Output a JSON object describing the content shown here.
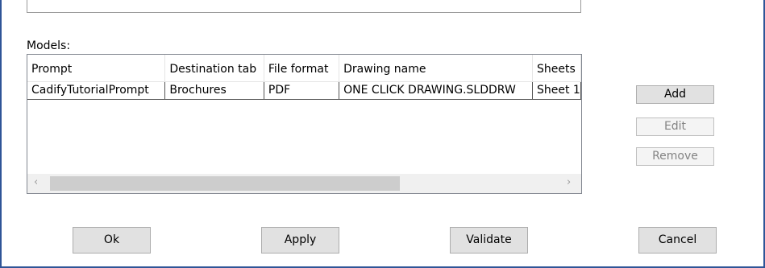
{
  "models_label": "Models:",
  "columns": [
    "Prompt",
    "Destination tab",
    "File format",
    "Drawing name",
    "Sheets"
  ],
  "rows": [
    [
      "CadifyTutorialPrompt",
      "Brochures",
      "PDF",
      "ONE CLICK DRAWING.SLDDRW",
      "Sheet 1"
    ]
  ],
  "scroll": {
    "left_arrow": "‹",
    "right_arrow": "›"
  },
  "side_buttons": {
    "add": "Add",
    "edit": "Edit",
    "remove": "Remove"
  },
  "bottom_buttons": {
    "ok": "Ok",
    "apply": "Apply",
    "validate": "Validate",
    "cancel": "Cancel"
  },
  "colors": {
    "accent_border": "#2f5597",
    "button_bg": "#e1e1e1",
    "scroll_thumb": "#cdcdcd"
  }
}
